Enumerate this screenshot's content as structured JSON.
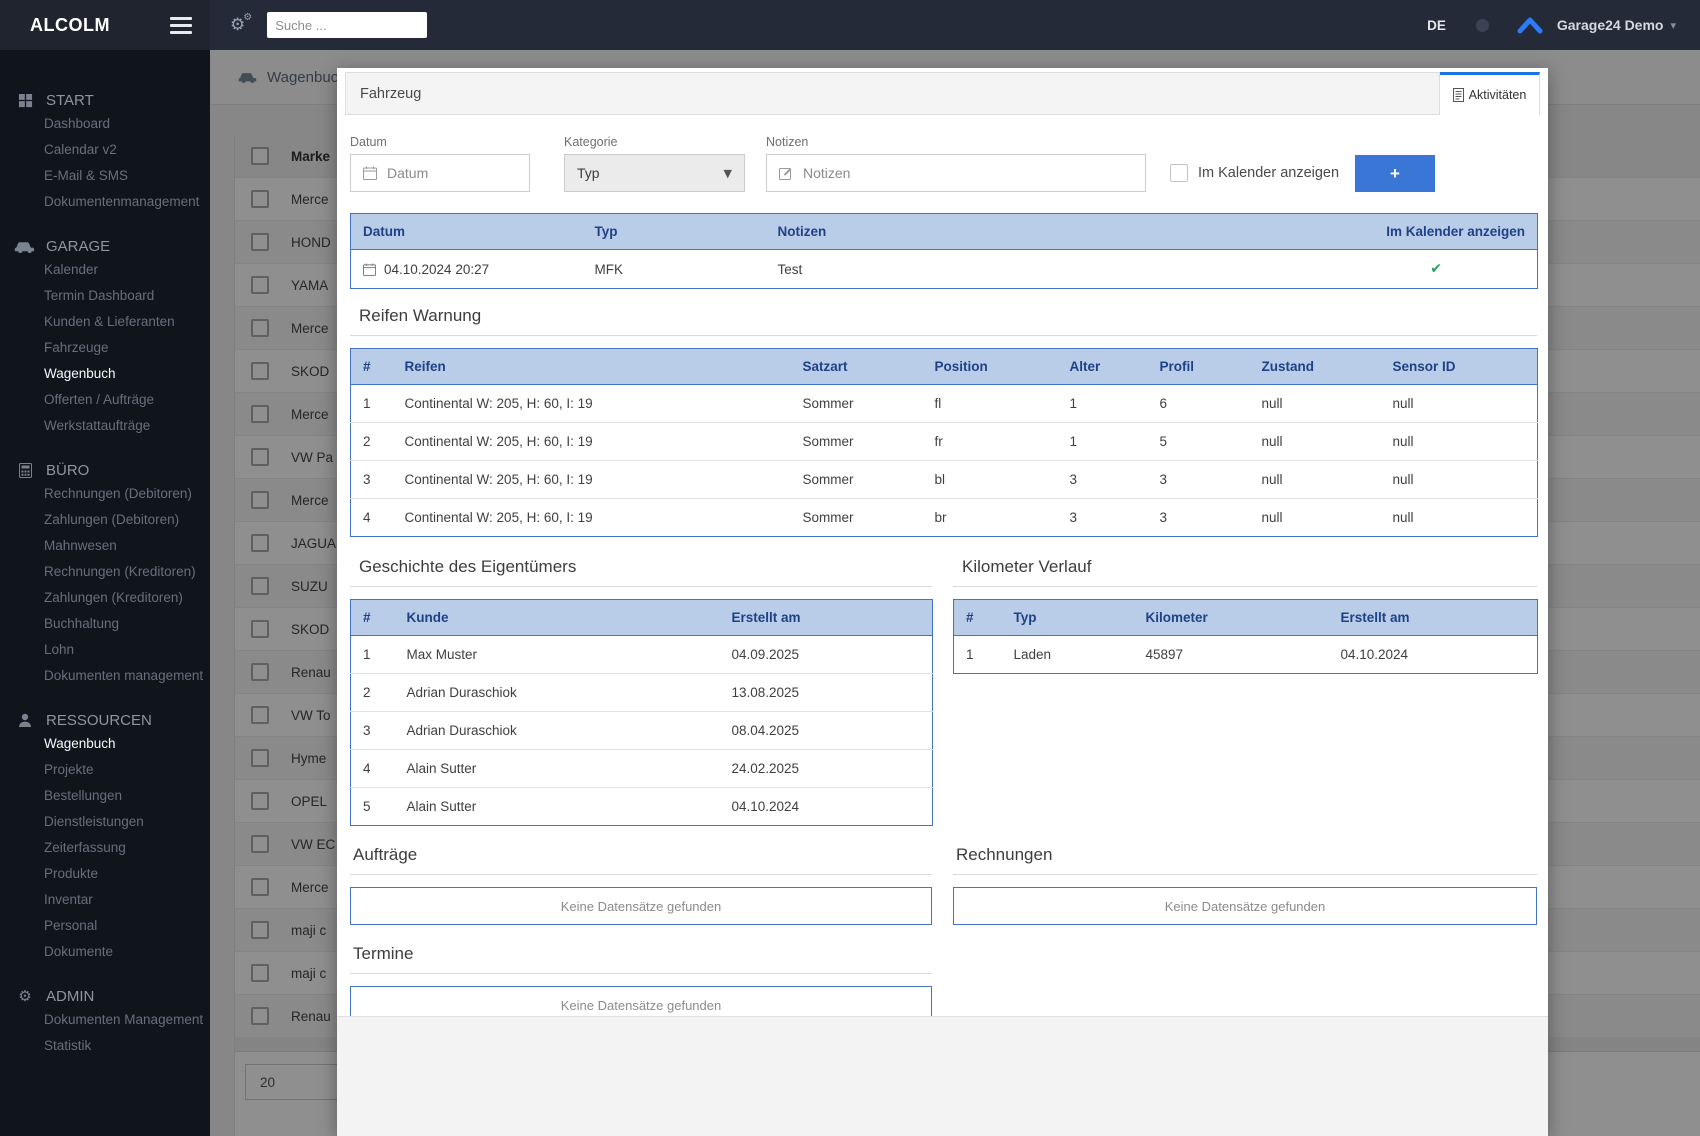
{
  "brand": "ALCOLM",
  "topbar": {
    "search_placeholder": "Suche ...",
    "language": "DE",
    "account": "Garage24 Demo"
  },
  "sidebar": {
    "sections": [
      {
        "label": "START",
        "icon": "grid-icon",
        "items": [
          {
            "label": "Dashboard"
          },
          {
            "label": "Calendar v2"
          },
          {
            "label": "E-Mail & SMS"
          },
          {
            "label": "Dokumentenmanagement"
          }
        ]
      },
      {
        "label": "GARAGE",
        "icon": "car-icon",
        "items": [
          {
            "label": "Kalender"
          },
          {
            "label": "Termin Dashboard"
          },
          {
            "label": "Kunden & Lieferanten"
          },
          {
            "label": "Fahrzeuge"
          },
          {
            "label": "Wagenbuch",
            "active": true
          },
          {
            "label": "Offerten / Aufträge"
          },
          {
            "label": "Werkstattaufträge"
          }
        ]
      },
      {
        "label": "BÜRO",
        "icon": "calculator-icon",
        "items": [
          {
            "label": "Rechnungen (Debitoren)"
          },
          {
            "label": "Zahlungen (Debitoren)"
          },
          {
            "label": "Mahnwesen"
          },
          {
            "label": "Rechnungen (Kreditoren)"
          },
          {
            "label": "Zahlungen (Kreditoren)"
          },
          {
            "label": "Buchhaltung"
          },
          {
            "label": "Lohn"
          },
          {
            "label": "Dokumenten management"
          }
        ]
      },
      {
        "label": "RESSOURCEN",
        "icon": "person-icon",
        "items": [
          {
            "label": "Wagenbuch",
            "active": true
          },
          {
            "label": "Projekte"
          },
          {
            "label": "Bestellungen"
          },
          {
            "label": "Dienstleistungen"
          },
          {
            "label": "Zeiterfassung"
          },
          {
            "label": "Produkte"
          },
          {
            "label": "Inventar"
          },
          {
            "label": "Personal"
          },
          {
            "label": "Dokumente"
          }
        ]
      },
      {
        "label": "ADMIN",
        "icon": "gear-icon",
        "items": [
          {
            "label": "Dokumenten Management"
          },
          {
            "label": "Statistik"
          }
        ]
      }
    ]
  },
  "background": {
    "page_title": "Wagenbuch",
    "list_header": "Marke",
    "rows": [
      "Merce",
      "HOND",
      "YAMA",
      "Merce",
      "SKOD",
      "Merce",
      "VW Pa",
      "Merce",
      "JAGUA",
      "SUZU",
      "SKOD",
      "Renau",
      "VW To",
      "Hyme",
      "OPEL",
      "VW EC",
      "Merce",
      "maji c",
      "maji c",
      "Renau"
    ],
    "page_size": "20"
  },
  "modal": {
    "tabs": [
      {
        "label": "Fahrzeug",
        "active": false
      },
      {
        "label": "Aktivitäten",
        "active": true
      }
    ],
    "form": {
      "datum_label": "Datum",
      "datum_placeholder": "Datum",
      "kategorie_label": "Kategorie",
      "kategorie_value": "Typ",
      "notizen_label": "Notizen",
      "notizen_placeholder": "Notizen",
      "kalender_label": "Im Kalender anzeigen",
      "add_label": "+"
    },
    "activities": {
      "headers": [
        "Datum",
        "Typ",
        "Notizen",
        "Im Kalender anzeigen"
      ],
      "rows": [
        {
          "datum": "04.10.2024 20:27",
          "typ": "MFK",
          "notizen": "Test",
          "checked": true
        }
      ]
    },
    "reifen": {
      "title": "Reifen Warnung",
      "headers": [
        "#",
        "Reifen",
        "Satzart",
        "Position",
        "Alter",
        "Profil",
        "Zustand",
        "Sensor ID"
      ],
      "rows": [
        [
          "1",
          "Continental W: 205, H: 60, I: 19",
          "Sommer",
          "fl",
          "1",
          "6",
          "null",
          "null"
        ],
        [
          "2",
          "Continental W: 205, H: 60, I: 19",
          "Sommer",
          "fr",
          "1",
          "5",
          "null",
          "null"
        ],
        [
          "3",
          "Continental W: 205, H: 60, I: 19",
          "Sommer",
          "bl",
          "3",
          "3",
          "null",
          "null"
        ],
        [
          "4",
          "Continental W: 205, H: 60, I: 19",
          "Sommer",
          "br",
          "3",
          "3",
          "null",
          "null"
        ]
      ]
    },
    "owners": {
      "title": "Geschichte des Eigentümers",
      "headers": [
        "#",
        "Kunde",
        "Erstellt am"
      ],
      "rows": [
        [
          "1",
          "Max Muster",
          "04.09.2025"
        ],
        [
          "2",
          "Adrian Duraschiok",
          "13.08.2025"
        ],
        [
          "3",
          "Adrian Duraschiok",
          "08.04.2025"
        ],
        [
          "4",
          "Alain Sutter",
          "24.02.2025"
        ],
        [
          "5",
          "Alain Sutter",
          "04.10.2024"
        ]
      ]
    },
    "km": {
      "title": "Kilometer Verlauf",
      "headers": [
        "#",
        "Typ",
        "Kilometer",
        "Erstellt am"
      ],
      "rows": [
        [
          "1",
          "Laden",
          "45897",
          "04.10.2024"
        ]
      ]
    },
    "auftraege": {
      "title": "Aufträge",
      "empty": "Keine Datensätze gefunden"
    },
    "rechnungen": {
      "title": "Rechnungen",
      "empty": "Keine Datensätze gefunden"
    },
    "termine": {
      "title": "Termine",
      "empty": "Keine Datensätze gefunden"
    }
  },
  "colors": {
    "accent": "#3a76d6",
    "tab_accent": "#1a73e8",
    "table_header_bg": "#b9cde8",
    "table_header_text": "#1f4287",
    "table_border": "#4472c4",
    "check_green": "#27a35e",
    "topbar_bg": "#252a38",
    "sidebar_bg": "#10141b"
  }
}
